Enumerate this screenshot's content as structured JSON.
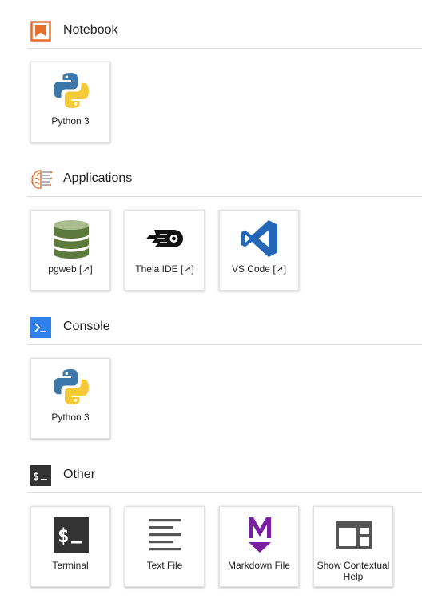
{
  "sections": [
    {
      "title": "Notebook",
      "icon": "notebook-icon",
      "cards": [
        {
          "label": "Python 3",
          "icon": "python-logo-icon"
        }
      ]
    },
    {
      "title": "Applications",
      "icon": "applications-brain-icon",
      "cards": [
        {
          "label": "pgweb [↗]",
          "icon": "database-icon"
        },
        {
          "label": "Theia IDE [↗]",
          "icon": "theia-icon"
        },
        {
          "label": "VS Code [↗]",
          "icon": "vscode-icon"
        }
      ]
    },
    {
      "title": "Console",
      "icon": "console-icon",
      "cards": [
        {
          "label": "Python 3",
          "icon": "python-logo-icon"
        }
      ]
    },
    {
      "title": "Other",
      "icon": "terminal-icon",
      "cards": [
        {
          "label": "Terminal",
          "icon": "terminal-icon"
        },
        {
          "label": "Text File",
          "icon": "text-file-icon"
        },
        {
          "label": "Markdown File",
          "icon": "markdown-icon"
        },
        {
          "label": "Show Contextual Help",
          "icon": "contextual-help-icon"
        }
      ]
    }
  ],
  "colors": {
    "notebook_orange": "#e46e2e",
    "console_blue": "#2f80ed",
    "python_blue": "#3b77a8",
    "python_yellow": "#f5c93a",
    "pgweb_green": "#5c7a3d",
    "vscode_blue": "#2567b7",
    "markdown_purple": "#7b1fa2",
    "icon_dark": "#3a3a3a"
  }
}
